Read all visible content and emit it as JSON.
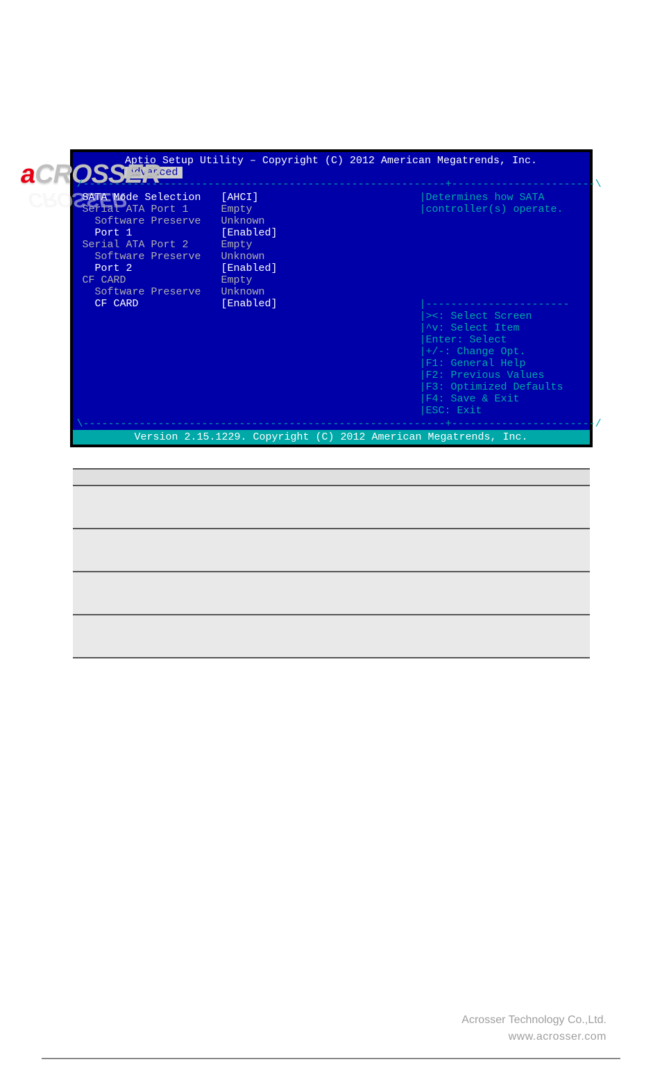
{
  "logo": {
    "prefix": "a",
    "rest": "CROSSER"
  },
  "bios": {
    "title": "Aptio Setup Utility – Copyright (C) 2012 American Megatrends, Inc.",
    "tab": "Advanced",
    "footer": "Version 2.15.1229. Copyright (C) 2012 American Megatrends, Inc.",
    "items": [
      {
        "label": "SATA Mode Selection",
        "value": "[AHCI]",
        "labelClass": "hl-white",
        "valueClass": "hl-white",
        "indent": 0
      },
      {
        "label": "",
        "value": "",
        "labelClass": "",
        "valueClass": "",
        "indent": 0
      },
      {
        "label": "Serial ATA Port 1",
        "value": "Empty",
        "labelClass": "",
        "valueClass": "",
        "indent": 0
      },
      {
        "label": "Software Preserve",
        "value": "Unknown",
        "labelClass": "",
        "valueClass": "",
        "indent": 1
      },
      {
        "label": "Port 1",
        "value": "[Enabled]",
        "labelClass": "hl-white",
        "valueClass": "hl-white",
        "indent": 1
      },
      {
        "label": "Serial ATA Port 2",
        "value": "Empty",
        "labelClass": "",
        "valueClass": "",
        "indent": 0
      },
      {
        "label": "Software Preserve",
        "value": "Unknown",
        "labelClass": "",
        "valueClass": "",
        "indent": 1
      },
      {
        "label": "Port 2",
        "value": "[Enabled]",
        "labelClass": "hl-white",
        "valueClass": "hl-white",
        "indent": 1
      },
      {
        "label": "CF CARD",
        "value": "Empty",
        "labelClass": "",
        "valueClass": "",
        "indent": 0
      },
      {
        "label": "Software Preserve",
        "value": "Unknown",
        "labelClass": "",
        "valueClass": "",
        "indent": 1
      },
      {
        "label": "CF CARD",
        "value": "[Enabled]",
        "labelClass": "hl-white",
        "valueClass": "hl-white",
        "indent": 1
      }
    ],
    "help_top": [
      "Determines how SATA",
      "controller(s) operate."
    ],
    "help_keys": [
      "><: Select Screen",
      "^v: Select Item",
      "Enter: Select",
      "+/-: Change Opt.",
      "F1: General Help",
      "F2: Previous Values",
      "F3: Optimized Defaults",
      "F4: Save & Exit",
      "ESC: Exit"
    ]
  },
  "table": {
    "headers": [
      "",
      "",
      ""
    ],
    "rows": [
      [
        "",
        "",
        ""
      ],
      [
        "",
        "",
        ""
      ],
      [
        "",
        "",
        ""
      ],
      [
        "",
        "",
        ""
      ]
    ]
  },
  "footer": {
    "company": "Acrosser Technology Co.,Ltd.",
    "url": "www.acrosser.com"
  }
}
